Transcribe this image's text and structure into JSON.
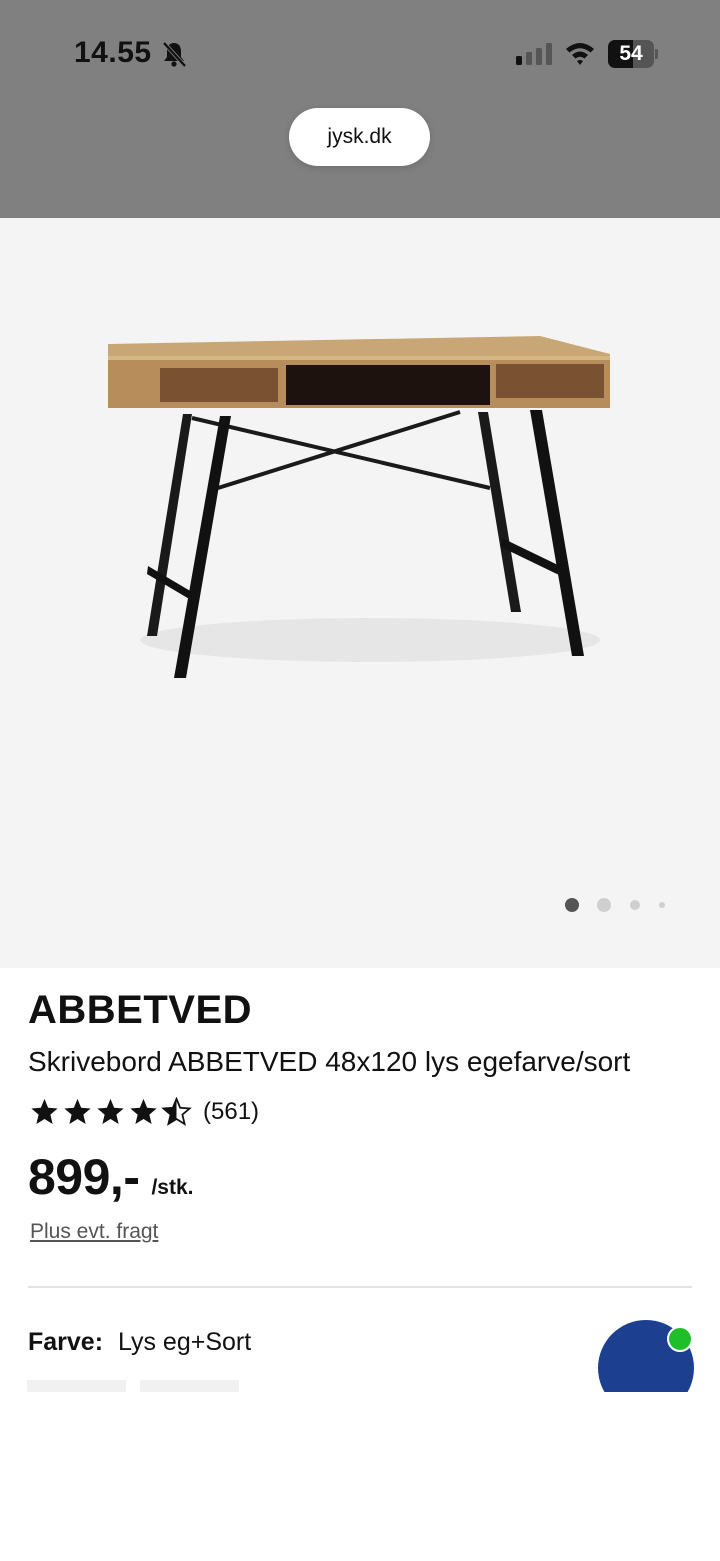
{
  "status_bar": {
    "time": "14.55",
    "battery_level": "54",
    "battery_fraction": 0.54,
    "icons": [
      "bell-slash-icon",
      "cellular-signal-icon",
      "wifi-icon",
      "battery-icon"
    ]
  },
  "browser": {
    "url": "jysk.dk"
  },
  "gallery": {
    "image": "desk-product-image",
    "dots_count": 4,
    "active_index": 0
  },
  "product": {
    "brand": "ABBETVED",
    "title": "Skrivebord ABBETVED 48x120 lys egefarve/sort",
    "rating": 4.5,
    "review_count": "(561)",
    "price": "899,-",
    "unit": "/stk.",
    "freight_link": "Plus evt. fragt",
    "color_label": "Farve:",
    "color_value": "Lys eg+Sort"
  },
  "chat": {
    "icon": "chat-bubble-icon",
    "status": "online"
  },
  "colors": {
    "top_bar": "#808080",
    "hero_bg": "#f4f4f4",
    "chat_blue": "#1c3f8f",
    "online_green": "#1fbf2a"
  }
}
